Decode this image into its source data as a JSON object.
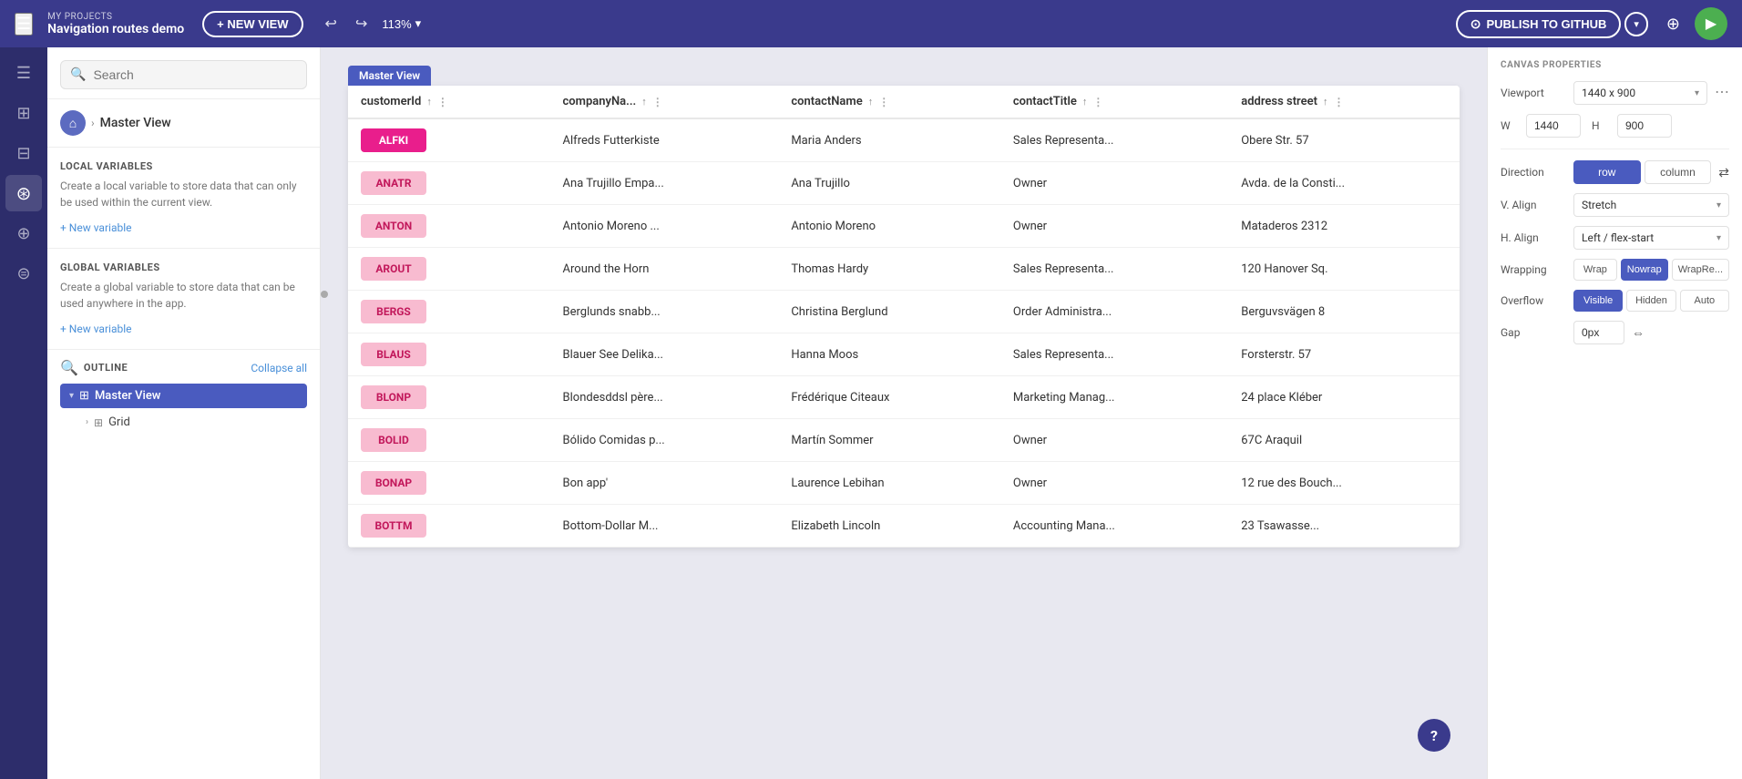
{
  "topbar": {
    "project_label": "MY PROJECTS",
    "project_name": "Navigation routes demo",
    "new_view_btn": "+ NEW VIEW",
    "zoom_level": "113%",
    "publish_btn": "PUBLISH TO GITHUB",
    "undo_icon": "↩",
    "redo_icon": "↪"
  },
  "search": {
    "placeholder": "Search"
  },
  "left_panel": {
    "master_view_label": "Master View",
    "local_variables_title": "LOCAL VARIABLES",
    "local_variables_desc": "Create a local variable to store data that can only be used within the current view.",
    "new_variable_local": "+ New variable",
    "global_variables_title": "GLOBAL VARIABLES",
    "global_variables_desc": "Create a global variable to store data that can be used anywhere in the app.",
    "new_variable_global": "+ New variable",
    "outline_title": "OUTLINE",
    "outline_collapse": "Collapse all",
    "outline_master_view": "Master View",
    "outline_grid": "Grid"
  },
  "canvas": {
    "view_label": "Master View"
  },
  "table": {
    "columns": [
      {
        "id": "customerId",
        "label": "customerId"
      },
      {
        "id": "companyName",
        "label": "companyNa..."
      },
      {
        "id": "contactName",
        "label": "contactName"
      },
      {
        "id": "contactTitle",
        "label": "contactTitle"
      },
      {
        "id": "addressStreet",
        "label": "address street"
      }
    ],
    "rows": [
      {
        "id": "ALFKI",
        "hot": true,
        "company": "Alfreds Futterkiste",
        "contact": "Maria Anders",
        "title": "Sales Representa...",
        "address": "Obere Str. 57"
      },
      {
        "id": "ANATR",
        "hot": false,
        "company": "Ana Trujillo Empa...",
        "contact": "Ana Trujillo",
        "title": "Owner",
        "address": "Avda. de la Consti..."
      },
      {
        "id": "ANTON",
        "hot": false,
        "company": "Antonio Moreno ...",
        "contact": "Antonio Moreno",
        "title": "Owner",
        "address": "Mataderos 2312"
      },
      {
        "id": "AROUT",
        "hot": false,
        "company": "Around the Horn",
        "contact": "Thomas Hardy",
        "title": "Sales Representa...",
        "address": "120 Hanover Sq."
      },
      {
        "id": "BERGS",
        "hot": false,
        "company": "Berglunds snabb...",
        "contact": "Christina Berglund",
        "title": "Order Administra...",
        "address": "Berguvsvägen 8"
      },
      {
        "id": "BLAUS",
        "hot": false,
        "company": "Blauer See Delika...",
        "contact": "Hanna Moos",
        "title": "Sales Representa...",
        "address": "Forsterstr. 57"
      },
      {
        "id": "BLONP",
        "hot": false,
        "company": "Blondesddsl père...",
        "contact": "Frédérique Citeaux",
        "title": "Marketing Manag...",
        "address": "24 place Kléber"
      },
      {
        "id": "BOLID",
        "hot": false,
        "company": "Bólido Comidas p...",
        "contact": "Martín Sommer",
        "title": "Owner",
        "address": "67C Araquil"
      },
      {
        "id": "BONAP",
        "hot": false,
        "company": "Bon app'",
        "contact": "Laurence Lebihan",
        "title": "Owner",
        "address": "12 rue des Bouch..."
      },
      {
        "id": "BOTTM",
        "hot": false,
        "company": "Bottom-Dollar M...",
        "contact": "Elizabeth Lincoln",
        "title": "Accounting Mana...",
        "address": "23 Tsawasse..."
      }
    ]
  },
  "right_panel": {
    "canvas_properties_title": "CANVAS PROPERTIES",
    "viewport_label": "Viewport",
    "viewport_value": "1440 x 900",
    "w_label": "W",
    "w_value": "1440",
    "h_label": "H",
    "h_value": "900",
    "direction_label": "Direction",
    "direction_row": "row",
    "direction_column": "column",
    "v_align_label": "V. Align",
    "v_align_value": "Stretch",
    "h_align_label": "H. Align",
    "h_align_value": "Left / flex-start",
    "wrapping_label": "Wrapping",
    "wrap_btn": "Wrap",
    "nowrap_btn": "Nowrap",
    "wrapre_btn": "WrapRe...",
    "overflow_label": "Overflow",
    "overflow_visible": "Visible",
    "overflow_hidden": "Hidden",
    "overflow_auto": "Auto",
    "gap_label": "Gap",
    "gap_value": "0px"
  },
  "help_btn": "?"
}
